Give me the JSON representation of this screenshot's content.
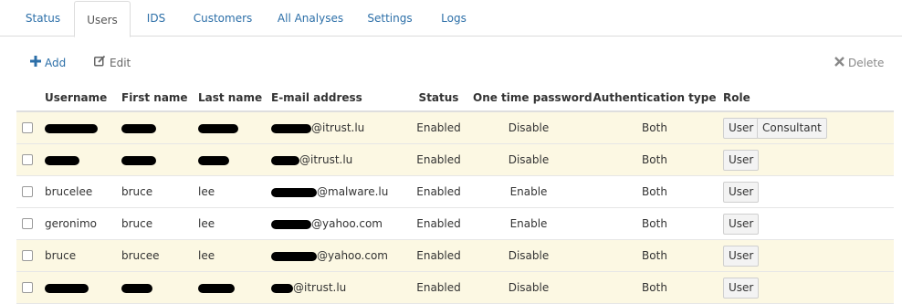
{
  "tabs": [
    {
      "label": "Status",
      "active": false
    },
    {
      "label": "Users",
      "active": true
    },
    {
      "label": "IDS",
      "active": false
    },
    {
      "label": "Customers",
      "active": false
    },
    {
      "label": "All Analyses",
      "active": false
    },
    {
      "label": "Settings",
      "active": false
    },
    {
      "label": "Logs",
      "active": false
    }
  ],
  "toolbar": {
    "add_label": "Add",
    "edit_label": "Edit",
    "delete_label": "Delete",
    "add_icon": "plus-icon",
    "edit_icon": "edit-icon",
    "delete_icon": "close-icon"
  },
  "table": {
    "columns": [
      "Username",
      "First name",
      "Last name",
      "E-mail address",
      "Status",
      "One time password",
      "Authentication type",
      "Role"
    ],
    "rows": [
      {
        "username": "",
        "first_name": "",
        "last_name": "",
        "email": "@itrust.lu",
        "status": "Enabled",
        "otp": "Disable",
        "auth": "Both",
        "roles": [
          "User",
          "Consultant"
        ],
        "highlight": true
      },
      {
        "username": "",
        "first_name": "",
        "last_name": "",
        "email": "@itrust.lu",
        "status": "Enabled",
        "otp": "Disable",
        "auth": "Both",
        "roles": [
          "User"
        ],
        "highlight": true
      },
      {
        "username": "brucelee",
        "first_name": "bruce",
        "last_name": "lee",
        "email": "@malware.lu",
        "status": "Enabled",
        "otp": "Enable",
        "auth": "Both",
        "roles": [
          "User"
        ],
        "highlight": false
      },
      {
        "username": "geronimo",
        "first_name": "bruce",
        "last_name": "lee",
        "email": "@yahoo.com",
        "status": "Enabled",
        "otp": "Enable",
        "auth": "Both",
        "roles": [
          "User"
        ],
        "highlight": false
      },
      {
        "username": "bruce",
        "first_name": "brucee",
        "last_name": "lee",
        "email": "@yahoo.com",
        "status": "Enabled",
        "otp": "Disable",
        "auth": "Both",
        "roles": [
          "User"
        ],
        "highlight": true
      },
      {
        "username": "",
        "first_name": "",
        "last_name": "",
        "email": "@itrust.lu",
        "status": "Enabled",
        "otp": "Disable",
        "auth": "Both",
        "roles": [
          "User"
        ],
        "highlight": true
      }
    ]
  },
  "colors": {
    "link": "#2c6fa8",
    "row_highlight": "#fcf8e3",
    "redaction": "#000000"
  }
}
